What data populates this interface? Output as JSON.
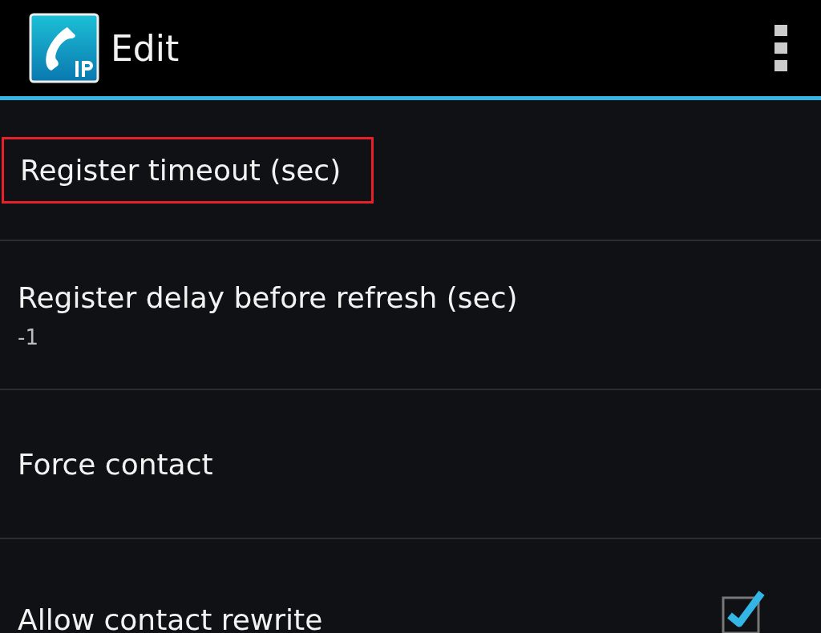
{
  "action_bar": {
    "title": "Edit"
  },
  "preferences": [
    {
      "kind": "text",
      "title": "Register timeout (sec)",
      "highlighted": true
    },
    {
      "kind": "text",
      "title": "Register delay before refresh (sec)",
      "summary": "-1",
      "highlighted": false
    },
    {
      "kind": "text",
      "title": "Force contact",
      "highlighted": false
    },
    {
      "kind": "checkbox",
      "title": "Allow contact rewrite",
      "checked": true,
      "highlighted": false
    }
  ]
}
